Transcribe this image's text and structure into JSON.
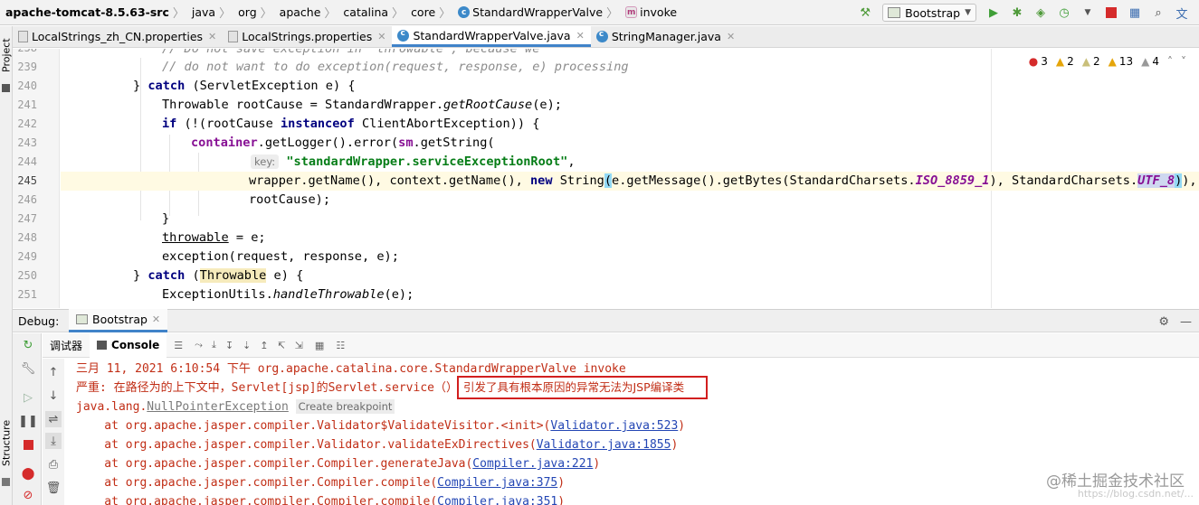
{
  "navbar": {
    "crumbs": [
      "apache-tomcat-8.5.63-src",
      "java",
      "org",
      "apache",
      "catalina",
      "core",
      "StandardWrapperValve",
      "invoke"
    ],
    "run_config": "Bootstrap"
  },
  "tabs": [
    {
      "label": "LocalStrings_zh_CN.properties",
      "active": false
    },
    {
      "label": "LocalStrings.properties",
      "active": false
    },
    {
      "label": "StandardWrapperValve.java",
      "active": true
    },
    {
      "label": "StringManager.java",
      "active": false
    }
  ],
  "left_strip": {
    "project": "Project",
    "structure": "Structure"
  },
  "inspections": {
    "errors": "3",
    "warnings": "2",
    "weak_warnings": "2",
    "typos": "13",
    "other": "4"
  },
  "editor": {
    "line_numbers": [
      "239",
      "240",
      "241",
      "242",
      "243",
      "244",
      "245",
      "246",
      "247",
      "248",
      "249",
      "250",
      "251"
    ],
    "current_line": "245",
    "code": {
      "l238": "// Do not save exception in 'throwable', because we",
      "l239": "// do not want to do exception(request, response, e) processing",
      "l240_a": "} ",
      "l240_kw": "catch",
      "l240_b": " (ServletException e) {",
      "l241_a": "Throwable rootCause = StandardWrapper.",
      "l241_it": "getRootCause",
      "l241_b": "(e);",
      "l242_kw1": "if",
      "l242_a": " (!(rootCause ",
      "l242_kw2": "instanceof",
      "l242_b": " ClientAbortException)) {",
      "l243_f1": "container",
      "l243_a": ".getLogger().error(",
      "l243_f2": "sm",
      "l243_b": ".getString(",
      "l244_hint": "key:",
      "l244_str": "\"standardWrapper.serviceExceptionRoot\"",
      "l244_b": ",",
      "l245_a": "wrapper.getName(), context.getName(), ",
      "l245_kw": "new",
      "l245_b": " String",
      "l245_p1": "(",
      "l245_c": "e.getMessage().getBytes(StandardCharsets.",
      "l245_f1": "ISO_8859_1",
      "l245_d": "), StandardCharsets.",
      "l245_f2": "UTF_8",
      "l245_p2": ")",
      "l245_e": "),",
      "l246": "rootCause);",
      "l247": "}",
      "l248_ul": "throwable",
      "l248_b": " = e;",
      "l249": "exception(request, response, e);",
      "l250_a": "} ",
      "l250_kw": "catch",
      "l250_b": " (",
      "l250_hl": "Throwable",
      "l250_c": " e) {",
      "l251_a": "ExceptionUtils.",
      "l251_it": "handleThrowable",
      "l251_b": "(e);"
    }
  },
  "debug": {
    "label": "Debug:",
    "session": "Bootstrap",
    "tab_debugger": "调试器",
    "tab_console": "Console"
  },
  "console": {
    "line1": "三月 11, 2021 6:10:54 下午 org.apache.catalina.core.StandardWrapperValve invoke",
    "line2": "严重: 在路径为的上下文中，Servlet[jsp]的Servlet.service（）",
    "line3_a": "java.lang.",
    "line3_npe": "NullPointerException",
    "line3_bp": "Create breakpoint",
    "frames": [
      {
        "text": "    at org.apache.jasper.compiler.Validator$ValidateVisitor.<init>(",
        "link": "Validator.java:523",
        "end": ")"
      },
      {
        "text": "    at org.apache.jasper.compiler.Validator.validateExDirectives(",
        "link": "Validator.java:1855",
        "end": ")"
      },
      {
        "text": "    at org.apache.jasper.compiler.Compiler.generateJava(",
        "link": "Compiler.java:221",
        "end": ")"
      },
      {
        "text": "    at org.apache.jasper.compiler.Compiler.compile(",
        "link": "Compiler.java:375",
        "end": ")"
      },
      {
        "text": "    at org.apache.jasper.compiler.Compiler.compile(",
        "link": "Compiler.java:351",
        "end": ")"
      }
    ]
  },
  "annotation": "引发了具有根本原因的异常无法为JSP编译类",
  "watermark": "@稀土掘金技术社区",
  "watermark_url": "https://blog.csdn.net/..."
}
